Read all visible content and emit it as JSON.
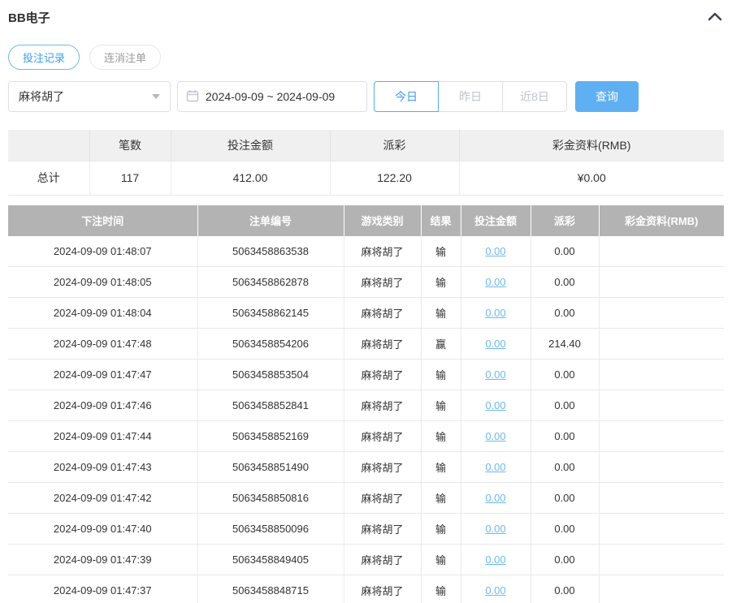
{
  "panel": {
    "title": "BB电子"
  },
  "tabs": [
    {
      "label": "投注记录",
      "active": true
    },
    {
      "label": "连消注单",
      "active": false
    }
  ],
  "filters": {
    "game_select": {
      "value": "麻将胡了"
    },
    "date_range": {
      "value": "2024-09-09 ~ 2024-09-09"
    },
    "quick_buttons": [
      {
        "label": "今日",
        "active": true
      },
      {
        "label": "昨日",
        "active": false
      },
      {
        "label": "近8日",
        "active": false
      }
    ],
    "search_label": "查询"
  },
  "summary": {
    "headers": [
      "",
      "笔数",
      "投注金额",
      "派彩",
      "彩金资料(RMB)"
    ],
    "row": {
      "label": "总计",
      "count": "117",
      "bet_amount": "412.00",
      "payout": "122.20",
      "jackpot": "¥0.00"
    }
  },
  "table": {
    "headers": [
      "下注时间",
      "注单编号",
      "游戏类别",
      "结果",
      "投注金额",
      "派彩",
      "彩金资料(RMB)"
    ],
    "rows": [
      {
        "time": "2024-09-09 01:48:07",
        "order_no": "5063458863538",
        "game": "麻将胡了",
        "result": "输",
        "bet": "0.00",
        "payout": "0.00",
        "jackpot": ""
      },
      {
        "time": "2024-09-09 01:48:05",
        "order_no": "5063458862878",
        "game": "麻将胡了",
        "result": "输",
        "bet": "0.00",
        "payout": "0.00",
        "jackpot": ""
      },
      {
        "time": "2024-09-09 01:48:04",
        "order_no": "5063458862145",
        "game": "麻将胡了",
        "result": "输",
        "bet": "0.00",
        "payout": "0.00",
        "jackpot": ""
      },
      {
        "time": "2024-09-09 01:47:48",
        "order_no": "5063458854206",
        "game": "麻将胡了",
        "result": "赢",
        "bet": "0.00",
        "payout": "214.40",
        "jackpot": ""
      },
      {
        "time": "2024-09-09 01:47:47",
        "order_no": "5063458853504",
        "game": "麻将胡了",
        "result": "输",
        "bet": "0.00",
        "payout": "0.00",
        "jackpot": ""
      },
      {
        "time": "2024-09-09 01:47:46",
        "order_no": "5063458852841",
        "game": "麻将胡了",
        "result": "输",
        "bet": "0.00",
        "payout": "0.00",
        "jackpot": ""
      },
      {
        "time": "2024-09-09 01:47:44",
        "order_no": "5063458852169",
        "game": "麻将胡了",
        "result": "输",
        "bet": "0.00",
        "payout": "0.00",
        "jackpot": ""
      },
      {
        "time": "2024-09-09 01:47:43",
        "order_no": "5063458851490",
        "game": "麻将胡了",
        "result": "输",
        "bet": "0.00",
        "payout": "0.00",
        "jackpot": ""
      },
      {
        "time": "2024-09-09 01:47:42",
        "order_no": "5063458850816",
        "game": "麻将胡了",
        "result": "输",
        "bet": "0.00",
        "payout": "0.00",
        "jackpot": ""
      },
      {
        "time": "2024-09-09 01:47:40",
        "order_no": "5063458850096",
        "game": "麻将胡了",
        "result": "输",
        "bet": "0.00",
        "payout": "0.00",
        "jackpot": ""
      },
      {
        "time": "2024-09-09 01:47:39",
        "order_no": "5063458849405",
        "game": "麻将胡了",
        "result": "输",
        "bet": "0.00",
        "payout": "0.00",
        "jackpot": ""
      },
      {
        "time": "2024-09-09 01:47:37",
        "order_no": "5063458848715",
        "game": "麻将胡了",
        "result": "输",
        "bet": "0.00",
        "payout": "0.00",
        "jackpot": ""
      }
    ]
  },
  "colors": {
    "accent_blue": "#3d9df0",
    "button_blue": "#5fb0f2",
    "link_blue": "#6cb8f2",
    "table_header_bg": "#b3b3b3",
    "summary_header_bg": "#f0f0f0"
  }
}
